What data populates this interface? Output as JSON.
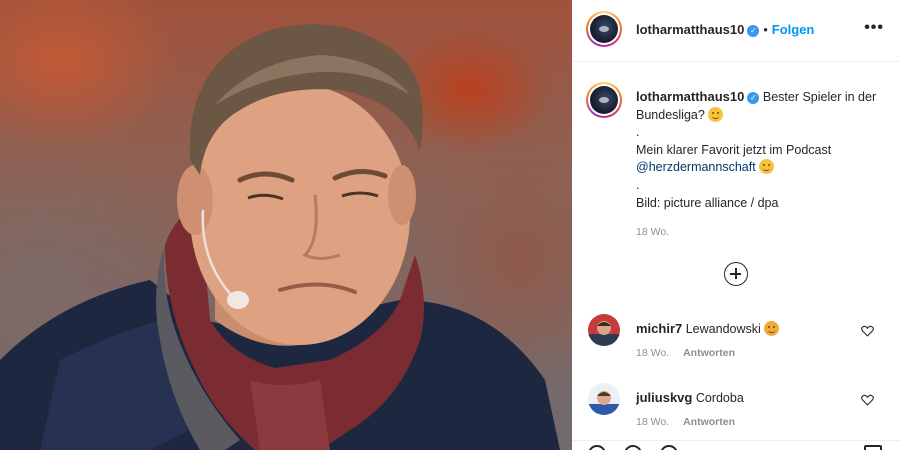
{
  "post": {
    "photo_alt": "photo",
    "author": {
      "username": "lotharmatthaus10",
      "verified_icon": "verified-badge-icon",
      "follow_separator": "•",
      "follow_label": "Folgen",
      "more_label": "•••"
    },
    "caption": {
      "username": "lotharmatthaus10",
      "line1": "Bester Spieler in der Bundesliga?",
      "dot1": ".",
      "line2": "Mein klarer Favorit jetzt im Podcast",
      "mention": "@herzdermannschaft",
      "dot2": ".",
      "line3": "Bild: picture alliance / dpa",
      "time": "18 Wo."
    },
    "comments": [
      {
        "username": "michir7",
        "text": "Lewandowski",
        "time": "18 Wo.",
        "reply_label": "Antworten"
      },
      {
        "username": "juliuskvg",
        "text": "Cordoba",
        "time": "18 Wo.",
        "reply_label": "Antworten"
      }
    ]
  },
  "colors": {
    "link_blue": "#0095f6",
    "mention_blue": "#00376b",
    "muted_gray": "#8e8e8e",
    "text_dark": "#262626"
  }
}
